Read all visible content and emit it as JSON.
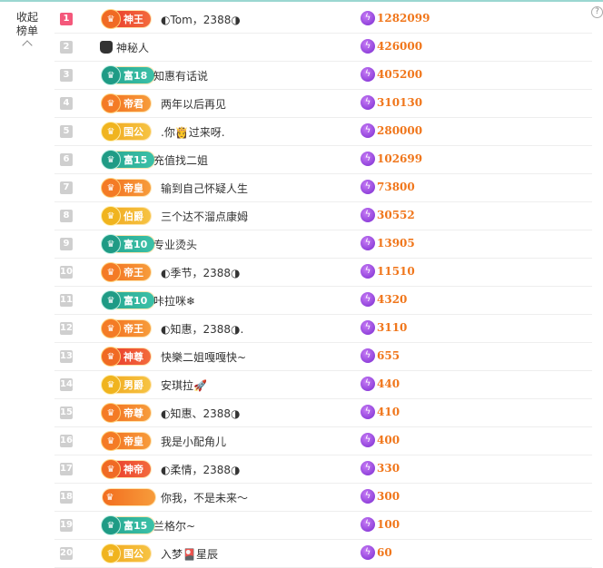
{
  "sidebar": {
    "collapse_label_1": "收起",
    "collapse_label_2": "榜单"
  },
  "rows": [
    {
      "rank": "1",
      "badge": "神王",
      "badge_style": "red",
      "name": "◐Tom，2388◑",
      "score": "1282099"
    },
    {
      "rank": "2",
      "badge": "",
      "badge_style": "none",
      "name": "神秘人",
      "score": "426000"
    },
    {
      "rank": "3",
      "badge": "富18",
      "badge_style": "green",
      "name": "知惠有话说",
      "score": "405200"
    },
    {
      "rank": "4",
      "badge": "帝君",
      "badge_style": "orange",
      "name": "两年以后再见",
      "score": "310130"
    },
    {
      "rank": "5",
      "badge": "国公",
      "badge_style": "gold",
      "name": ".你👸过来呀.",
      "score": "280000"
    },
    {
      "rank": "6",
      "badge": "富15",
      "badge_style": "green",
      "name": "充值找二姐",
      "score": "102699"
    },
    {
      "rank": "7",
      "badge": "帝皇",
      "badge_style": "orange",
      "name": "输到自己怀疑人生",
      "score": "73800"
    },
    {
      "rank": "8",
      "badge": "伯爵",
      "badge_style": "gold",
      "name": "三个达不溜点康姆",
      "score": "30552"
    },
    {
      "rank": "9",
      "badge": "富10",
      "badge_style": "green",
      "name": "专业烫头",
      "score": "13905"
    },
    {
      "rank": "10",
      "badge": "帝王",
      "badge_style": "orange",
      "name": "◐季节，2388◑",
      "score": "11510"
    },
    {
      "rank": "11",
      "badge": "富10",
      "badge_style": "green",
      "name": "咔拉咪❄",
      "score": "4320"
    },
    {
      "rank": "12",
      "badge": "帝王",
      "badge_style": "orange",
      "name": "◐知惠，2388◑.",
      "score": "3110"
    },
    {
      "rank": "13",
      "badge": "神尊",
      "badge_style": "red",
      "name": "快樂二姐嘎嘎快~",
      "score": "655"
    },
    {
      "rank": "14",
      "badge": "男爵",
      "badge_style": "gold",
      "name": "安琪拉🚀",
      "score": "440"
    },
    {
      "rank": "15",
      "badge": "帝尊",
      "badge_style": "orange",
      "name": "◐知惠、2388◑",
      "score": "410"
    },
    {
      "rank": "16",
      "badge": "帝皇",
      "badge_style": "orange",
      "name": "我是小配角儿",
      "score": "400"
    },
    {
      "rank": "17",
      "badge": "神帝",
      "badge_style": "red",
      "name": "◐柔情，2388◑",
      "score": "330"
    },
    {
      "rank": "18",
      "badge": "",
      "badge_style": "blank",
      "name": "你我，不是未来～",
      "score": "300"
    },
    {
      "rank": "19",
      "badge": "富15",
      "badge_style": "green",
      "name": "兰格尔~",
      "score": "100"
    },
    {
      "rank": "20",
      "badge": "国公",
      "badge_style": "gold",
      "name": "入梦🎴星辰",
      "score": "60"
    }
  ],
  "colors": {
    "score": "#f0761b",
    "rank_first": "#f4587b",
    "rank_default": "#cfcfcf",
    "coin": "#9b3fe0"
  },
  "icons": {
    "help": "question-mark-icon",
    "coin": "lightning-coin-icon",
    "collapse": "chevron-up-icon"
  }
}
